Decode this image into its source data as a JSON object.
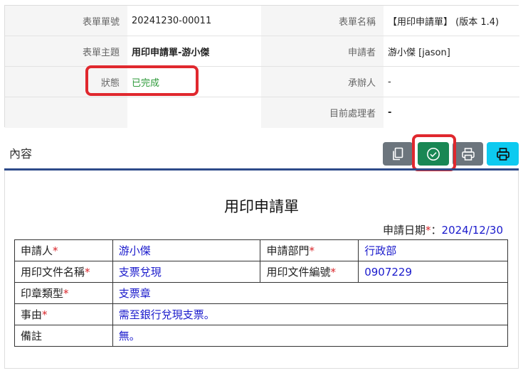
{
  "info": {
    "form_no_label": "表單單號",
    "form_no": "20241230-00011",
    "form_name_label": "表單名稱",
    "form_name": "【用印申請單】 (版本 1.4)",
    "subject_label": "表單主題",
    "subject": "用印申請單-游小傑",
    "applicant_label": "申請者",
    "applicant": "游小傑 [jason]",
    "status_label": "狀態",
    "status": "已完成",
    "handler_label": "承辦人",
    "handler": "-",
    "current_label": "目前處理者",
    "current": "-"
  },
  "toolbar": {
    "title": "內容",
    "buttons": [
      {
        "icon": "copy-icon",
        "color": "#6c757d"
      },
      {
        "icon": "check-circle-icon",
        "color": "#198754"
      },
      {
        "icon": "printer-icon",
        "color": "#6c757d"
      },
      {
        "icon": "printer-icon",
        "color": "#0dcaf0"
      }
    ]
  },
  "form": {
    "title": "用印申請單",
    "date_label": "申請日期",
    "date_req": "*",
    "date_sep": "：",
    "date": "2024/12/30",
    "req_mark": "*",
    "rows": {
      "applicant_label": "申請人",
      "applicant": "游小傑",
      "dept_label": "申請部門",
      "dept": "行政部",
      "doc_name_label": "用印文件名稱",
      "doc_name": "支票兌現",
      "doc_no_label": "用印文件編號",
      "doc_no": "0907229",
      "seal_label": "印章類型",
      "seal": "支票章",
      "reason_label": "事由",
      "reason": "需至銀行兌現支票。",
      "note_label": "備註",
      "note": "無。"
    }
  },
  "colors": {
    "highlight": "#e0282e",
    "status_done": "#2e9a3a",
    "value_blue": "#1a1acc",
    "rule": "#2e4b8a"
  }
}
